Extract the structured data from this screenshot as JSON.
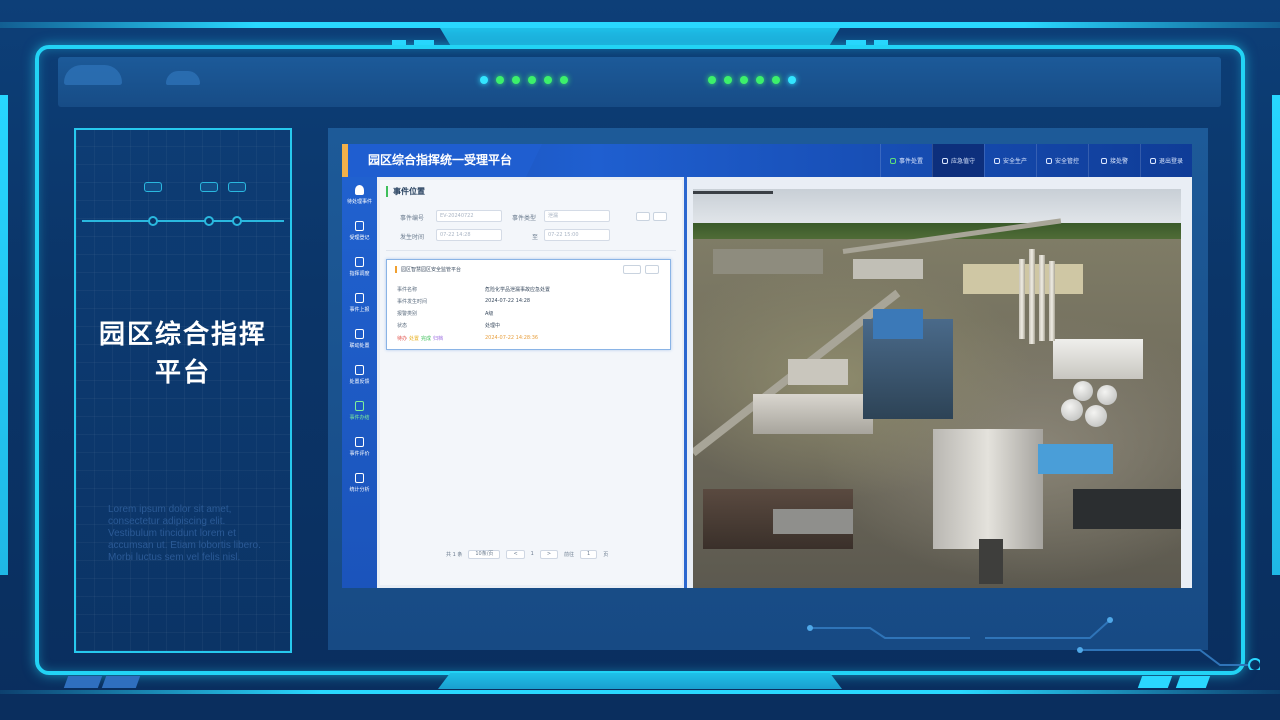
{
  "platform": {
    "title_line1": "园区综合指挥",
    "title_line2": "平台",
    "lorem": "Lorem ipsum dolor sit amet, consectetur adipiscing elit. Vestibulum tincidunt lorem et accumsan ut. Etiam lobortis libero. Morbi luctus sem vel felis nisl."
  },
  "app": {
    "title": "园区综合指挥统一受理平台",
    "nav": [
      {
        "label": "事件处置",
        "icon": "phone-icon"
      },
      {
        "label": "应急值守",
        "icon": "flag-icon"
      },
      {
        "label": "安全生产",
        "icon": "clipboard-icon"
      },
      {
        "label": "安全管控",
        "icon": "shield-icon"
      },
      {
        "label": "接处警",
        "icon": "headset-icon"
      },
      {
        "label": "退出登录",
        "icon": "back-icon"
      }
    ],
    "sidebar": [
      {
        "label": "待处理事件",
        "icon": "bell-icon"
      },
      {
        "label": "受理登记",
        "icon": "edit-icon"
      },
      {
        "label": "指挥调度",
        "icon": "dispatch-icon"
      },
      {
        "label": "事件上报",
        "icon": "doc-icon"
      },
      {
        "label": "联动处置",
        "icon": "doc-icon"
      },
      {
        "label": "处置反馈",
        "icon": "doc-icon"
      },
      {
        "label": "事件办结",
        "icon": "doc-icon"
      },
      {
        "label": "事件评价",
        "icon": "doc-icon"
      },
      {
        "label": "统计分析",
        "icon": "doc-icon"
      }
    ],
    "form": {
      "title": "事件位置",
      "field1_label": "事件编号",
      "field1_value": "EV-20240722",
      "field2_label": "事件类型",
      "field2_value": "泄漏",
      "field3_label": "发生时间",
      "field3_value": "07-22 14:28",
      "field4_label": "至",
      "field4_value": "07-22 15:00"
    },
    "card": {
      "title": "园区智慧园区安全监管平台",
      "rows": [
        {
          "label": "事件名称",
          "value": "危险化学品泄漏事故应急处置"
        },
        {
          "label": "事件发生时间",
          "value": "2024-07-22 14:28"
        },
        {
          "label": "报警类别",
          "value": "A级"
        },
        {
          "label": "状态",
          "value": "处理中"
        }
      ],
      "status_label_1": "待办",
      "status_label_2": "处置",
      "status_label_3": "完成",
      "status_label_4": "归档",
      "timestamp": "2024-07-22 14:28:36"
    },
    "pager": {
      "total": "共 1 条",
      "per_page": "10条/页",
      "prev": "<",
      "page": "1",
      "next": ">",
      "goto": "前往",
      "goto_page": "1",
      "unit": "页"
    }
  },
  "colors": {
    "accent": "#22d3f5",
    "led_green": "#3cf06b",
    "led_cyan": "#33e5ff",
    "app_blue": "#1f5fd0"
  }
}
